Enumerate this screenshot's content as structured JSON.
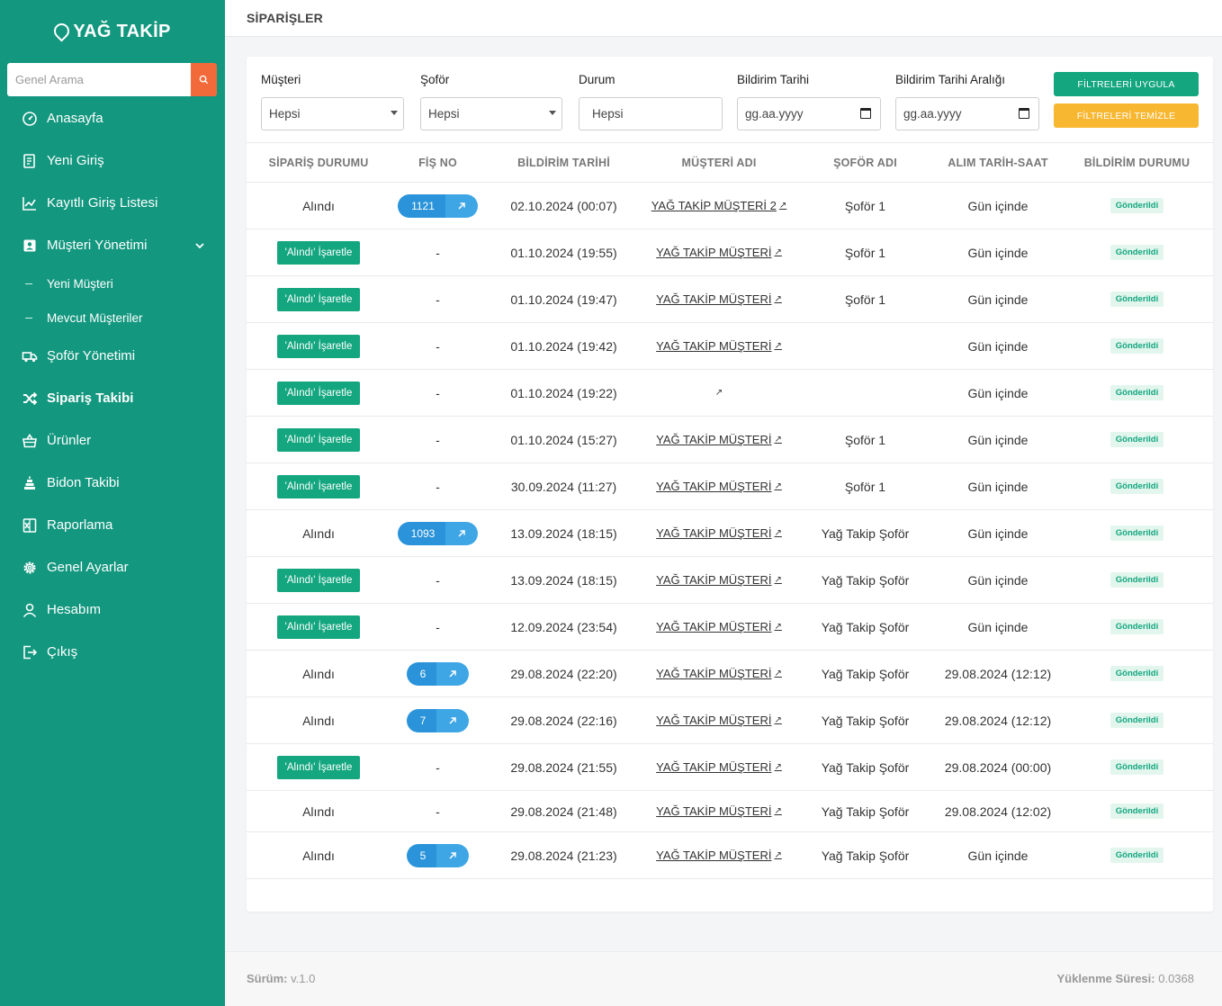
{
  "app": {
    "logo": "YAĞ TAKİP",
    "search_placeholder": "Genel Arama",
    "accent": "#13977f",
    "search_button_color": "#f36a3a"
  },
  "sidebar": {
    "items": [
      {
        "label": "Anasayfa",
        "icon": "dashboard-icon"
      },
      {
        "label": "Yeni Giriş",
        "icon": "form-icon"
      },
      {
        "label": "Kayıtlı Giriş Listesi",
        "icon": "chart-line-icon"
      },
      {
        "label": "Müşteri Yönetimi",
        "icon": "contact-icon"
      },
      {
        "label": "Yeni Müşteri"
      },
      {
        "label": "Mevcut Müşteriler"
      },
      {
        "label": "Şoför Yönetimi",
        "icon": "truck-icon"
      },
      {
        "label": "Sipariş Takibi",
        "icon": "shuffle-icon"
      },
      {
        "label": "Ürünler",
        "icon": "basket-icon"
      },
      {
        "label": "Bidon Takibi",
        "icon": "stack-icon"
      },
      {
        "label": "Raporlama",
        "icon": "excel-icon"
      },
      {
        "label": "Genel Ayarlar",
        "icon": "gear-icon"
      },
      {
        "label": "Hesabım",
        "icon": "user-icon"
      },
      {
        "label": "Çıkış",
        "icon": "logout-icon"
      }
    ]
  },
  "header": {
    "title": "SİPARİŞLER"
  },
  "filters": {
    "musteri": {
      "label": "Müşteri",
      "value": "Hepsi"
    },
    "sofor": {
      "label": "Şoför",
      "value": "Hepsi"
    },
    "durum": {
      "label": "Durum",
      "value": "Hepsi"
    },
    "bildirim_tarihi": {
      "label": "Bildirim Tarihi",
      "value": "gg.aa.yyyy"
    },
    "bildirim_araligi": {
      "label": "Bildirim Tarihi Aralığı",
      "value": "gg.aa.yyyy"
    },
    "apply_label": "FİLTRELERİ UYGULA",
    "clear_label": "FİLTRELERİ TEMİZLE"
  },
  "table": {
    "columns": [
      "SİPARİŞ DURUMU",
      "FİŞ NO",
      "BİLDİRİM TARİHİ",
      "MÜŞTERİ ADI",
      "ŞOFÖR ADI",
      "ALIM TARİH-SAAT",
      "BİLDİRİM DURUMU"
    ],
    "mark_label": "'Alındı' İşaretle",
    "received_label": "Alındı",
    "rows": [
      {
        "status": "Alındı",
        "fis": "1121",
        "date": "02.10.2024 (00:07)",
        "customer": "YAĞ TAKİP MÜŞTERİ 2",
        "driver": "Şoför 1",
        "pickup": "Gün içinde",
        "notify": "Gönderildi"
      },
      {
        "status": "mark",
        "fis": "-",
        "date": "01.10.2024 (19:55)",
        "customer": "YAĞ TAKİP MÜŞTERİ",
        "driver": "Şoför 1",
        "pickup": "Gün içinde",
        "notify": "Gönderildi"
      },
      {
        "status": "mark",
        "fis": "-",
        "date": "01.10.2024 (19:47)",
        "customer": "YAĞ TAKİP MÜŞTERİ",
        "driver": "Şoför 1",
        "pickup": "Gün içinde",
        "notify": "Gönderildi"
      },
      {
        "status": "mark",
        "fis": "-",
        "date": "01.10.2024 (19:42)",
        "customer": "YAĞ TAKİP MÜŞTERİ",
        "driver": "",
        "pickup": "Gün içinde",
        "notify": "Gönderildi"
      },
      {
        "status": "mark",
        "fis": "-",
        "date": "01.10.2024 (19:22)",
        "customer": "",
        "driver": "",
        "pickup": "Gün içinde",
        "notify": "Gönderildi"
      },
      {
        "status": "mark",
        "fis": "-",
        "date": "01.10.2024 (15:27)",
        "customer": "YAĞ TAKİP MÜŞTERİ",
        "driver": "Şoför 1",
        "pickup": "Gün içinde",
        "notify": "Gönderildi"
      },
      {
        "status": "mark",
        "fis": "-",
        "date": "30.09.2024 (11:27)",
        "customer": "YAĞ TAKİP MÜŞTERİ",
        "driver": "Şoför 1",
        "pickup": "Gün içinde",
        "notify": "Gönderildi"
      },
      {
        "status": "Alındı",
        "fis": "1093",
        "date": "13.09.2024 (18:15)",
        "customer": "YAĞ TAKİP MÜŞTERİ",
        "driver": "Yağ Takip Şoför",
        "pickup": "Gün içinde",
        "notify": "Gönderildi"
      },
      {
        "status": "mark",
        "fis": "-",
        "date": "13.09.2024 (18:15)",
        "customer": "YAĞ TAKİP MÜŞTERİ",
        "driver": "Yağ Takip Şoför",
        "pickup": "Gün içinde",
        "notify": "Gönderildi"
      },
      {
        "status": "mark",
        "fis": "-",
        "date": "12.09.2024 (23:54)",
        "customer": "YAĞ TAKİP MÜŞTERİ",
        "driver": "Yağ Takip Şoför",
        "pickup": "Gün içinde",
        "notify": "Gönderildi"
      },
      {
        "status": "Alındı",
        "fis": "6",
        "date": "29.08.2024 (22:20)",
        "customer": "YAĞ TAKİP MÜŞTERİ",
        "driver": "Yağ Takip Şoför",
        "pickup": "29.08.2024 (12:12)",
        "notify": "Gönderildi"
      },
      {
        "status": "Alındı",
        "fis": "7",
        "date": "29.08.2024 (22:16)",
        "customer": "YAĞ TAKİP MÜŞTERİ",
        "driver": "Yağ Takip Şoför",
        "pickup": "29.08.2024 (12:12)",
        "notify": "Gönderildi"
      },
      {
        "status": "mark",
        "fis": "-",
        "date": "29.08.2024 (21:55)",
        "customer": "YAĞ TAKİP MÜŞTERİ",
        "driver": "Yağ Takip Şoför",
        "pickup": "29.08.2024 (00:00)",
        "notify": "Gönderildi"
      },
      {
        "status": "Alındı",
        "fis": "-",
        "date": "29.08.2024 (21:48)",
        "customer": "YAĞ TAKİP MÜŞTERİ",
        "driver": "Yağ Takip Şoför",
        "pickup": "29.08.2024 (12:02)",
        "notify": "Gönderildi"
      },
      {
        "status": "Alındı",
        "fis": "5",
        "date": "29.08.2024 (21:23)",
        "customer": "YAĞ TAKİP MÜŞTERİ",
        "driver": "Yağ Takip Şoför",
        "pickup": "Gün içinde",
        "notify": "Gönderildi"
      }
    ]
  },
  "footer": {
    "version_label": "Sürüm:",
    "version": "v.1.0",
    "load_label": "Yüklenme Süresi:",
    "load_time": "0.0368"
  }
}
